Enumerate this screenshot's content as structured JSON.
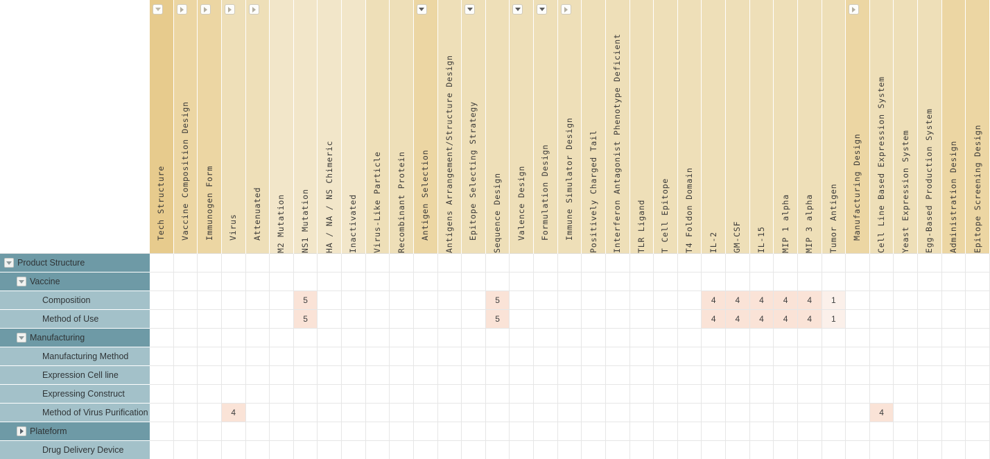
{
  "meta": {
    "colors": {
      "row_parent": "#6e9aa6",
      "row_child": "#a3c1c9",
      "header_level1": "#e7cb8d",
      "header_level2": "#ecd6a3",
      "header_level3": "#eedfb8",
      "header_level4": "#f2e6c9",
      "header_level5": "#f4ead2",
      "cell_value_high": "#fae3d7",
      "cell_value_low": "#fbf0ea"
    }
  },
  "columns": [
    {
      "label": "Tech Structure",
      "shade": "lvl1",
      "toggle": "expanded",
      "toggle_style": "dim",
      "toggle_pos": "left"
    },
    {
      "label": "Vaccine Composition Design",
      "shade": "lvl2",
      "toggle": "collapsed",
      "toggle_pos": "left"
    },
    {
      "label": "Immunogen Form",
      "shade": "lvl2",
      "toggle": "collapsed",
      "toggle_pos": "left"
    },
    {
      "label": "Virus",
      "shade": "lvl3",
      "toggle": "collapsed",
      "toggle_pos": "left"
    },
    {
      "label": "Attenuated",
      "shade": "lvl3",
      "toggle": "collapsed",
      "toggle_pos": "left"
    },
    {
      "label": "M2 Mutation",
      "shade": "lvl4",
      "toggle": "none"
    },
    {
      "label": "NS1 Mutation",
      "shade": "lvl4",
      "toggle": "none"
    },
    {
      "label": "HA / NA / NS Chimeric",
      "shade": "lvl4",
      "toggle": "none"
    },
    {
      "label": "Inactivated",
      "shade": "lvl4",
      "toggle": "none"
    },
    {
      "label": "Virus-Like Particle",
      "shade": "lvl3",
      "toggle": "none"
    },
    {
      "label": "Recombinant Protein",
      "shade": "lvl3",
      "toggle": "none"
    },
    {
      "label": "Antigen Selection",
      "shade": "lvl2",
      "toggle": "expanded",
      "toggle_pos": "left"
    },
    {
      "label": "Antigens Arrangement/Structure Design",
      "shade": "lvl3",
      "toggle": "none"
    },
    {
      "label": "Epitope Selecting Strategy",
      "shade": "lvl3",
      "toggle": "expanded",
      "toggle_pos": "left"
    },
    {
      "label": "Sequence Design",
      "shade": "lvl3",
      "toggle": "none"
    },
    {
      "label": "Valence Design",
      "shade": "lvl3",
      "toggle": "expanded",
      "toggle_pos": "left"
    },
    {
      "label": "Formulation Design",
      "shade": "lvl3",
      "toggle": "expanded",
      "toggle_pos": "left"
    },
    {
      "label": "Immune Simulator Design",
      "shade": "lvl3",
      "toggle": "collapsed",
      "toggle_pos": "left"
    },
    {
      "label": "Positively Charged Tail",
      "shade": "lvl3",
      "toggle": "none"
    },
    {
      "label": "Interferon Antagonist Phenotype Deficient",
      "shade": "lvl3",
      "toggle": "none"
    },
    {
      "label": "TLR Ligand",
      "shade": "lvl3",
      "toggle": "none"
    },
    {
      "label": "T Cell Epitope",
      "shade": "lvl3",
      "toggle": "none"
    },
    {
      "label": "T4 Foldon Domain",
      "shade": "lvl3",
      "toggle": "none"
    },
    {
      "label": "IL-2",
      "shade": "lvl3",
      "toggle": "none"
    },
    {
      "label": "GM-CSF",
      "shade": "lvl3",
      "toggle": "none"
    },
    {
      "label": "IL-15",
      "shade": "lvl3",
      "toggle": "none"
    },
    {
      "label": "MIP 1 alpha",
      "shade": "lvl3",
      "toggle": "none"
    },
    {
      "label": "MIP 3 alpha",
      "shade": "lvl3",
      "toggle": "none"
    },
    {
      "label": "Tumor Antigen",
      "shade": "lvl3",
      "toggle": "none"
    },
    {
      "label": "Manufacturing Design",
      "shade": "lvl2",
      "toggle": "collapsed",
      "toggle_pos": "left"
    },
    {
      "label": "Cell Line Based Expression System",
      "shade": "lvl3",
      "toggle": "none"
    },
    {
      "label": "Yeast Expression System",
      "shade": "lvl3",
      "toggle": "none"
    },
    {
      "label": "Egg-Based Production System",
      "shade": "lvl3",
      "toggle": "none"
    },
    {
      "label": "Administration Design",
      "shade": "lvl2",
      "toggle": "none"
    },
    {
      "label": "Epitope Screening Design",
      "shade": "lvl2",
      "toggle": "none"
    }
  ],
  "rows": [
    {
      "label": "Product Structure",
      "level": "parent",
      "indent": 0,
      "toggle": "expanded"
    },
    {
      "label": "Vaccine",
      "level": "parent",
      "indent": 1,
      "toggle": "expanded"
    },
    {
      "label": "Composition",
      "level": "child",
      "indent": 2,
      "toggle": "none"
    },
    {
      "label": "Method of Use",
      "level": "child",
      "indent": 2,
      "toggle": "none"
    },
    {
      "label": "Manufacturing",
      "level": "parent",
      "indent": 1,
      "toggle": "expanded"
    },
    {
      "label": "Manufacturing Method",
      "level": "child",
      "indent": 2,
      "toggle": "none"
    },
    {
      "label": "Expression Cell line",
      "level": "child",
      "indent": 2,
      "toggle": "none"
    },
    {
      "label": "Expressing Construct",
      "level": "child",
      "indent": 2,
      "toggle": "none"
    },
    {
      "label": "Method of Virus Purification",
      "level": "child",
      "indent": 2,
      "toggle": "none"
    },
    {
      "label": "Plateform",
      "level": "parent",
      "indent": 1,
      "toggle": "collapsed"
    },
    {
      "label": "Drug Delivery Device",
      "level": "child",
      "indent": 2,
      "toggle": "none"
    }
  ],
  "cells": [
    [
      null,
      null,
      null,
      null,
      null,
      null,
      null,
      null,
      null,
      null,
      null,
      null,
      null,
      null,
      null,
      null,
      null,
      null,
      null,
      null,
      null,
      null,
      null,
      null,
      null,
      null,
      null,
      null,
      null,
      null,
      null,
      null,
      null,
      null,
      null
    ],
    [
      null,
      null,
      null,
      null,
      null,
      null,
      null,
      null,
      null,
      null,
      null,
      null,
      null,
      null,
      null,
      null,
      null,
      null,
      null,
      null,
      null,
      null,
      null,
      null,
      null,
      null,
      null,
      null,
      null,
      null,
      null,
      null,
      null,
      null,
      null
    ],
    [
      null,
      null,
      null,
      null,
      null,
      null,
      "5",
      null,
      null,
      null,
      null,
      null,
      null,
      null,
      "5",
      null,
      null,
      null,
      null,
      null,
      null,
      null,
      null,
      "4",
      "4",
      "4",
      "4",
      "4",
      "1",
      null,
      null,
      null,
      null,
      null,
      null
    ],
    [
      null,
      null,
      null,
      null,
      null,
      null,
      "5",
      null,
      null,
      null,
      null,
      null,
      null,
      null,
      "5",
      null,
      null,
      null,
      null,
      null,
      null,
      null,
      null,
      "4",
      "4",
      "4",
      "4",
      "4",
      "1",
      null,
      null,
      null,
      null,
      null,
      null
    ],
    [
      null,
      null,
      null,
      null,
      null,
      null,
      null,
      null,
      null,
      null,
      null,
      null,
      null,
      null,
      null,
      null,
      null,
      null,
      null,
      null,
      null,
      null,
      null,
      null,
      null,
      null,
      null,
      null,
      null,
      null,
      null,
      null,
      null,
      null,
      null
    ],
    [
      null,
      null,
      null,
      null,
      null,
      null,
      null,
      null,
      null,
      null,
      null,
      null,
      null,
      null,
      null,
      null,
      null,
      null,
      null,
      null,
      null,
      null,
      null,
      null,
      null,
      null,
      null,
      null,
      null,
      null,
      null,
      null,
      null,
      null,
      null
    ],
    [
      null,
      null,
      null,
      null,
      null,
      null,
      null,
      null,
      null,
      null,
      null,
      null,
      null,
      null,
      null,
      null,
      null,
      null,
      null,
      null,
      null,
      null,
      null,
      null,
      null,
      null,
      null,
      null,
      null,
      null,
      null,
      null,
      null,
      null,
      null
    ],
    [
      null,
      null,
      null,
      null,
      null,
      null,
      null,
      null,
      null,
      null,
      null,
      null,
      null,
      null,
      null,
      null,
      null,
      null,
      null,
      null,
      null,
      null,
      null,
      null,
      null,
      null,
      null,
      null,
      null,
      null,
      null,
      null,
      null,
      null,
      null
    ],
    [
      null,
      null,
      null,
      "4",
      null,
      null,
      null,
      null,
      null,
      null,
      null,
      null,
      null,
      null,
      null,
      null,
      null,
      null,
      null,
      null,
      null,
      null,
      null,
      null,
      null,
      null,
      null,
      null,
      null,
      null,
      "4",
      null,
      null,
      null,
      null
    ],
    [
      null,
      null,
      null,
      null,
      null,
      null,
      null,
      null,
      null,
      null,
      null,
      null,
      null,
      null,
      null,
      null,
      null,
      null,
      null,
      null,
      null,
      null,
      null,
      null,
      null,
      null,
      null,
      null,
      null,
      null,
      null,
      null,
      null,
      null,
      null
    ],
    [
      null,
      null,
      null,
      null,
      null,
      null,
      null,
      null,
      null,
      null,
      null,
      null,
      null,
      null,
      null,
      null,
      null,
      null,
      null,
      null,
      null,
      null,
      null,
      null,
      null,
      null,
      null,
      null,
      null,
      null,
      null,
      null,
      null,
      null,
      null
    ]
  ]
}
